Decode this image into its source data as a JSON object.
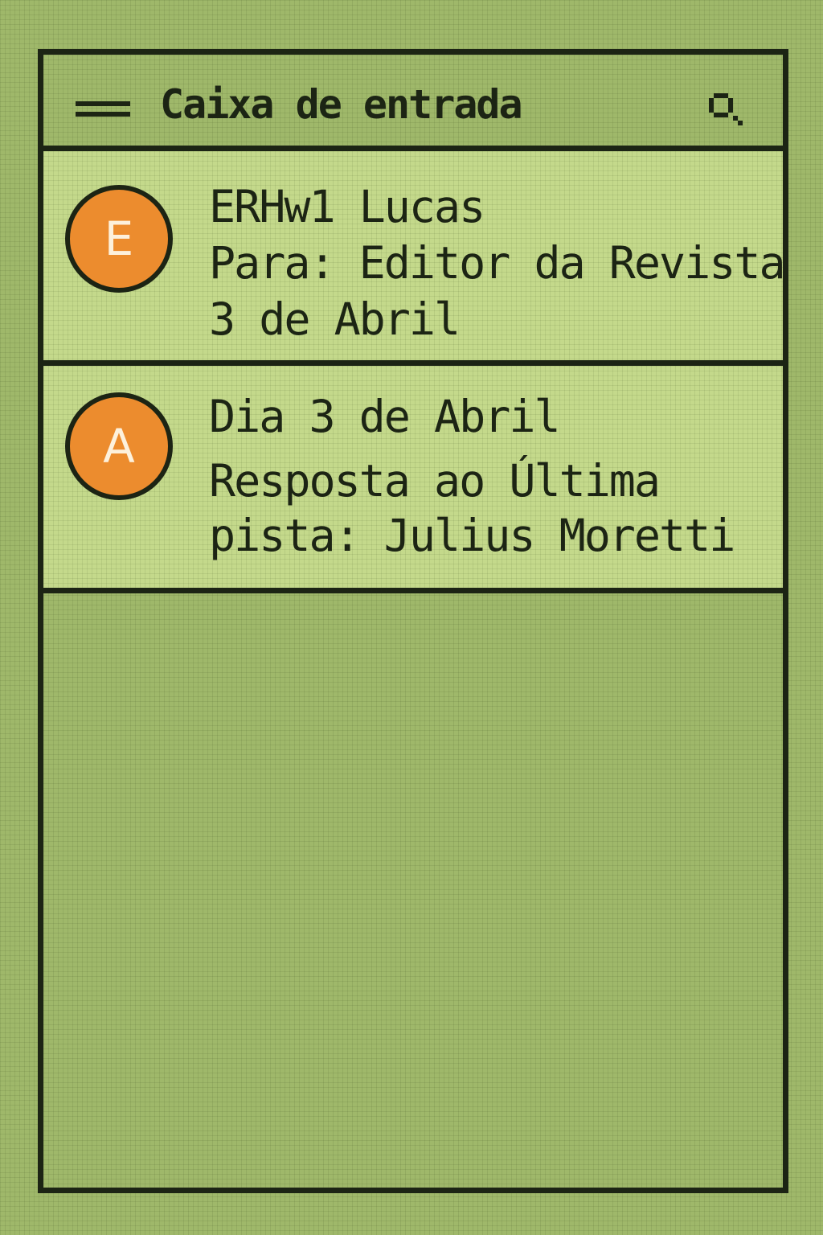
{
  "header": {
    "title": "Caixa de entrada",
    "menu_icon": "hamburger-menu-icon",
    "search_icon": "search-icon"
  },
  "messages": [
    {
      "avatar_letter": "E",
      "line1": "ERHw1 Lucas",
      "line2": "Para: Editor da Revista",
      "line3": "3 de Abril"
    },
    {
      "avatar_letter": "A",
      "line1": "Dia 3 de Abril",
      "line2": "Resposta ao Última",
      "line3": "pista: Julius Moretti"
    }
  ],
  "colors": {
    "screen_background": "#9fb86a",
    "item_background": "#c4d98b",
    "ink": "#1c2414",
    "avatar_fill": "#ec8c2e",
    "avatar_letter": "#fdf1dc"
  }
}
